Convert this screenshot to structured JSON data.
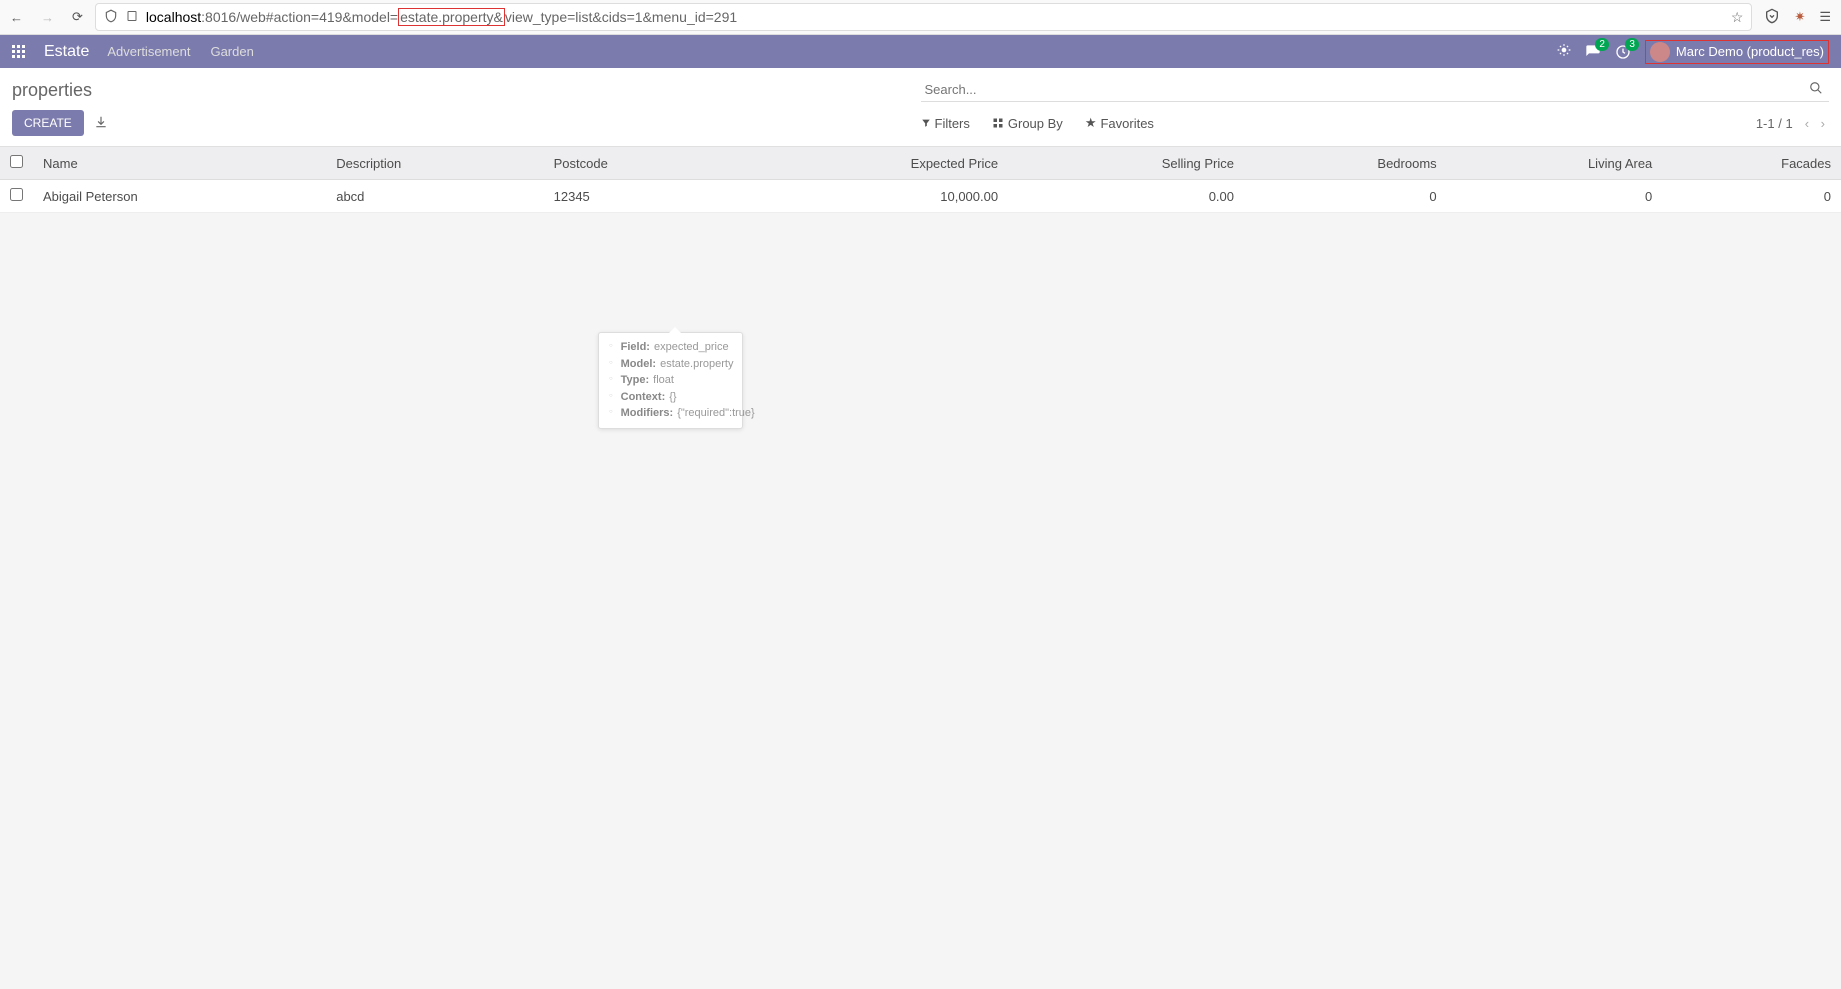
{
  "browser": {
    "url_pre": ":8016/web#action=419&model=",
    "url_highlight": "estate.property&",
    "url_post": "view_type=list&cids=1&menu_id=291",
    "host": "localhost"
  },
  "appbar": {
    "title": "Estate",
    "menu": [
      "Advertisement",
      "Garden"
    ],
    "msg_badge": "2",
    "activity_badge": "3",
    "user": "Marc Demo (product_res)"
  },
  "cp": {
    "breadcrumb": "properties",
    "create": "CREATE",
    "search_placeholder": "Search...",
    "filters": "Filters",
    "groupby": "Group By",
    "favorites": "Favorites",
    "pager": "1-1 / 1"
  },
  "table": {
    "headers": {
      "name": "Name",
      "desc": "Description",
      "postcode": "Postcode",
      "expected": "Expected Price",
      "selling": "Selling Price",
      "bedrooms": "Bedrooms",
      "living": "Living Area",
      "facades": "Facades"
    },
    "row": {
      "name": "Abigail Peterson",
      "desc": "abcd",
      "postcode": "12345",
      "expected": "10,000.00",
      "selling": "0.00",
      "bedrooms": "0",
      "living": "0",
      "facades": "0"
    }
  },
  "tooltip": {
    "field_l": "Field:",
    "field_v": "expected_price",
    "model_l": "Model:",
    "model_v": "estate.property",
    "type_l": "Type:",
    "type_v": "float",
    "ctx_l": "Context:",
    "ctx_v": "{}",
    "mod_l": "Modifiers:",
    "mod_v": "{\"required\":true}"
  }
}
